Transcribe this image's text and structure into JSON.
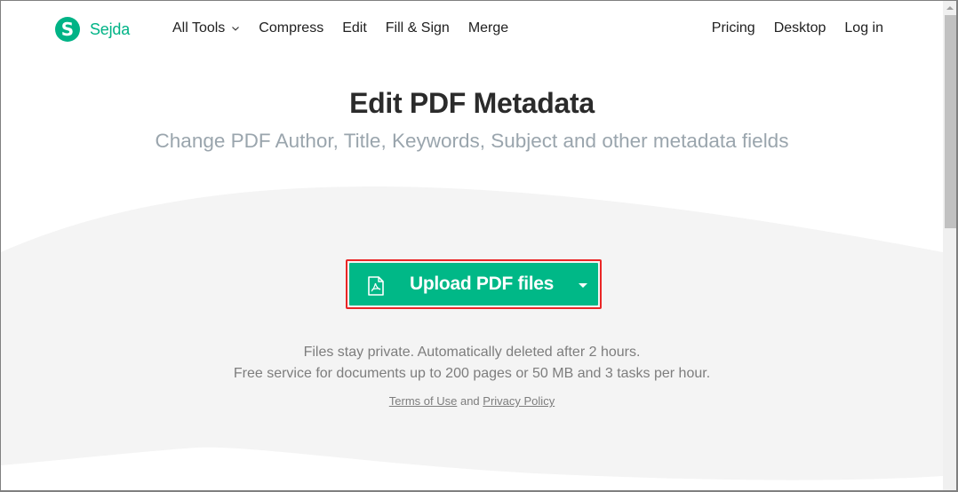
{
  "brand": {
    "logo_letter": "S",
    "name": "Sejda",
    "color": "#00b386"
  },
  "nav": {
    "left": [
      {
        "label": "All Tools",
        "has_dropdown": true
      },
      {
        "label": "Compress"
      },
      {
        "label": "Edit"
      },
      {
        "label": "Fill & Sign"
      },
      {
        "label": "Merge"
      }
    ],
    "right": [
      {
        "label": "Pricing"
      },
      {
        "label": "Desktop"
      },
      {
        "label": "Log in"
      }
    ]
  },
  "hero": {
    "title": "Edit PDF Metadata",
    "subtitle": "Change PDF Author, Title, Keywords, Subject and other metadata fields"
  },
  "upload": {
    "label": "Upload PDF files",
    "icon": "pdf-file-icon",
    "button_color": "#00b887",
    "highlight_color": "#ea2626"
  },
  "info": {
    "line1": "Files stay private. Automatically deleted after 2 hours.",
    "line2": "Free service for documents up to 200 pages or 50 MB and 3 tasks per hour."
  },
  "legal": {
    "terms": "Terms of Use",
    "conjunction": " and ",
    "privacy": "Privacy Policy"
  }
}
